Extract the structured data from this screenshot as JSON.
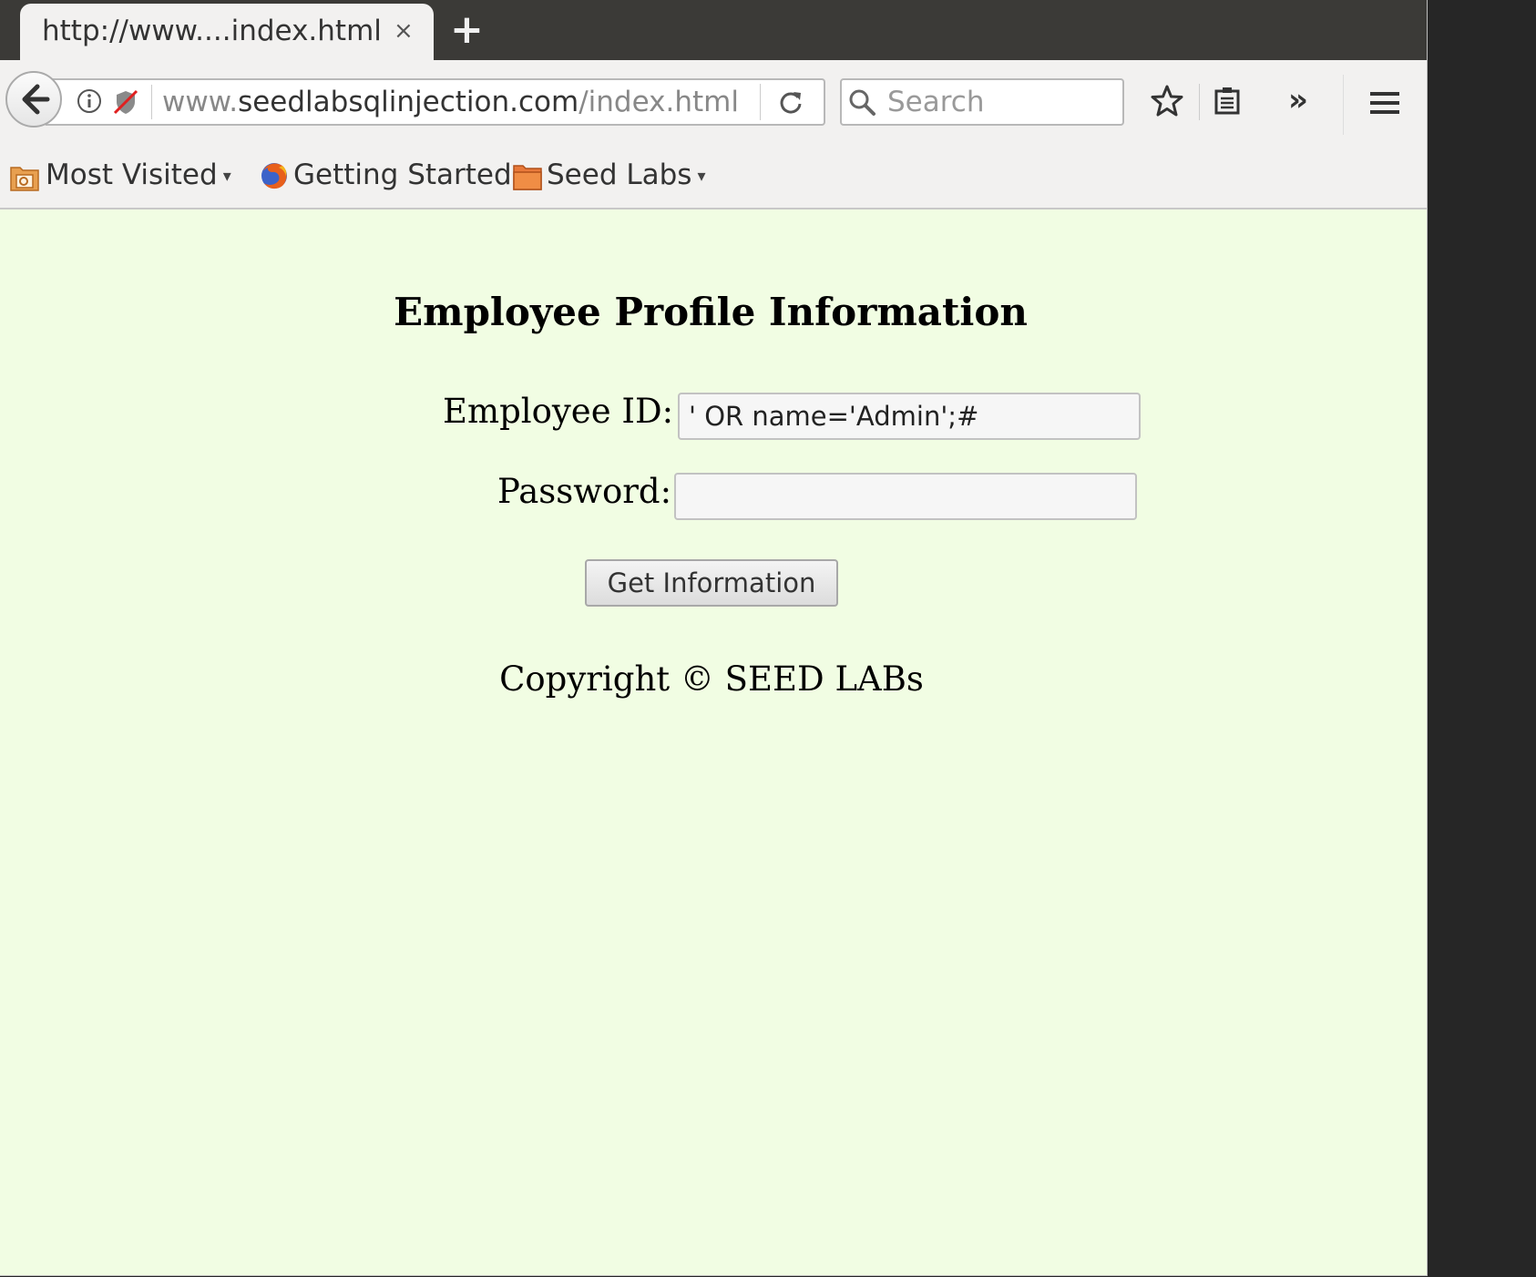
{
  "browser": {
    "tab": {
      "title": "http://www....index.html",
      "close_symbol": "×"
    },
    "newtab_symbol": "+",
    "url": {
      "host_prefix": "www.",
      "host": "seedlabsqlinjection.com",
      "path": "/index.html"
    },
    "search_placeholder": "Search",
    "overflow_symbol": "»",
    "bookmarks": [
      {
        "label": "Most Visited",
        "has_dropdown": true,
        "icon": "smart-folder-icon"
      },
      {
        "label": "Getting Started",
        "has_dropdown": false,
        "icon": "firefox-icon"
      },
      {
        "label": "Seed Labs",
        "has_dropdown": true,
        "icon": "folder-icon"
      }
    ],
    "caret_symbol": "▾"
  },
  "page": {
    "title": "Employee Profile Information",
    "employee_id_label": "Employee ID:",
    "employee_id_value": "' OR name='Admin';#",
    "password_label": "Password:",
    "password_value": "",
    "submit_label": "Get Information",
    "copyright": "Copyright © SEED LABs",
    "background_color": "#f1fde3"
  }
}
